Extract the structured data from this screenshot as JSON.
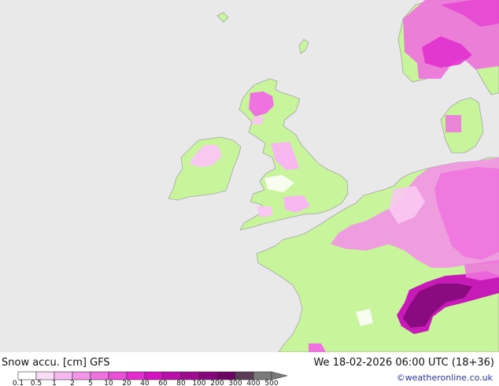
{
  "title": {
    "product": "Snow accu. [cm]",
    "model": "GFS",
    "valid_time": "We 18-02-2026 06:00 UTC (18+36)"
  },
  "copyright": "©weatheronline.co.uk",
  "legend": {
    "unit": "cm",
    "thresholds": [
      "0.1",
      "0.5",
      "1",
      "2",
      "5",
      "10",
      "20",
      "40",
      "60",
      "80",
      "100",
      "200",
      "300",
      "400",
      "500"
    ],
    "colors": [
      "#ffffff",
      "#fbdcf6",
      "#f6b8ee",
      "#f295e7",
      "#ee72df",
      "#e94fd7",
      "#e22cce",
      "#d214c0",
      "#b90fa9",
      "#9f0a91",
      "#850679",
      "#6b0462",
      "#5c3b58",
      "#7a7a7a"
    ]
  },
  "colors": {
    "sea": "#e9e9e9",
    "land": "#c8f59c",
    "coast": "#a5a5a5",
    "snow_light": "#f9c8f1",
    "snow_medium": "#ee72df",
    "snow_heavy": "#c61bb6",
    "snow_extreme": "#8a0a80"
  }
}
